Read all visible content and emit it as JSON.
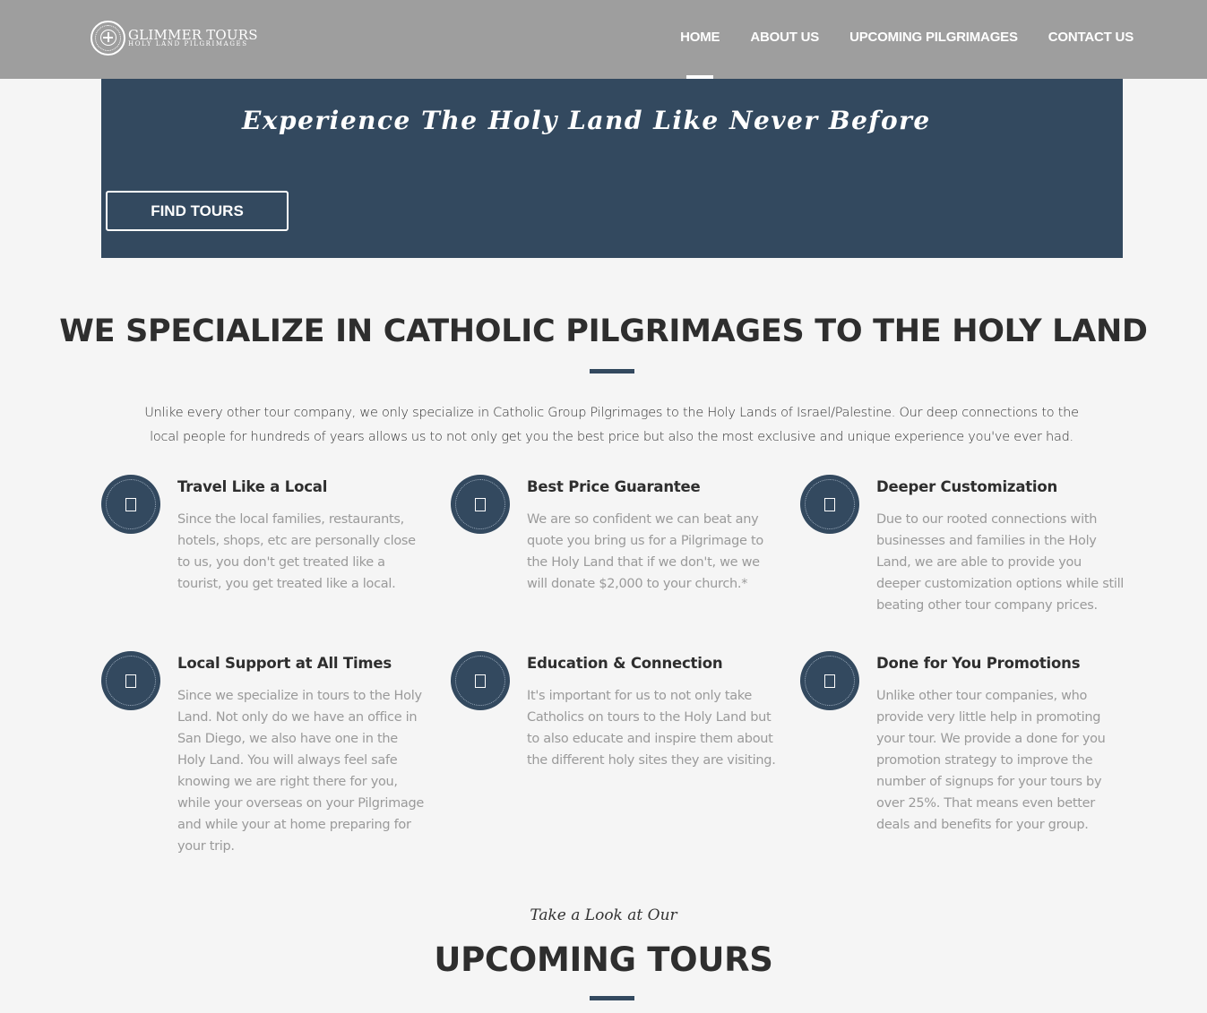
{
  "header": {
    "logo": {
      "name": "GLIMMER TOURS",
      "tagline": "HOLY LAND PILGRIMAGES",
      "icon": "cross-in-circle-icon"
    },
    "nav": [
      {
        "label": "HOME",
        "active": true
      },
      {
        "label": "ABOUT US",
        "active": false
      },
      {
        "label": "UPCOMING PILGRIMAGES",
        "active": false
      },
      {
        "label": "CONTACT US",
        "active": false
      }
    ]
  },
  "hero": {
    "title": "Experience The Holy Land Like Never Before",
    "button_label": "FIND TOURS"
  },
  "specialize": {
    "title": "WE SPECIALIZE IN CATHOLIC PILGRIMAGES TO THE HOLY LAND",
    "intro": "Unlike every other tour company, we only specialize in Catholic Group Pilgrimages to the Holy Lands of Israel/Palestine. Our deep connections to the local people for hundreds of years allows us to not only get you the best price but also the most exclusive and unique experience you've ever had."
  },
  "features": [
    {
      "title": "Travel Like a Local",
      "text": "Since the local families, restaurants, hotels, shops, etc are personally close to us, you don't get treated like a tourist, you get treated like a local.",
      "icon": "feature-icon"
    },
    {
      "title": "Best Price Guarantee",
      "text": "We are so confident we can beat any quote you bring us for a Pilgrimage to the Holy Land that if we don't, we we will donate $2,000 to your church.*",
      "icon": "feature-icon"
    },
    {
      "title": "Deeper Customization",
      "text": "Due to our rooted connections with businesses and families in the Holy Land, we are able to provide you deeper customization options while still beating other tour company prices.",
      "icon": "feature-icon"
    },
    {
      "title": "Local Support at All Times",
      "text": "Since we specialize in tours to the Holy Land. Not only do we have an office in San Diego, we also have one in the Holy Land. You will always feel safe knowing we are right there for you, while your overseas on your Pilgrimage and while your at home preparing for your trip.",
      "icon": "feature-icon"
    },
    {
      "title": "Education & Connection",
      "text": "It's important for us to not only take Catholics on tours to the Holy Land but to also educate and inspire them about the different holy sites they are visiting.",
      "icon": "feature-icon"
    },
    {
      "title": "Done for You Promotions",
      "text": "Unlike other tour companies, who provide very little help in promoting your tour. We provide a done for you promotion strategy to improve the number of signups for your tours by over 25%. That means even better deals and benefits for your group.",
      "icon": "feature-icon"
    }
  ],
  "upcoming": {
    "subtitle": "Take a Look at Our",
    "title": "UPCOMING TOURS"
  },
  "colors": {
    "header_bg": "#9e9e9e",
    "accent": "#33495f",
    "page_bg": "#f5f5f5",
    "muted_text": "#9a9a9a"
  }
}
